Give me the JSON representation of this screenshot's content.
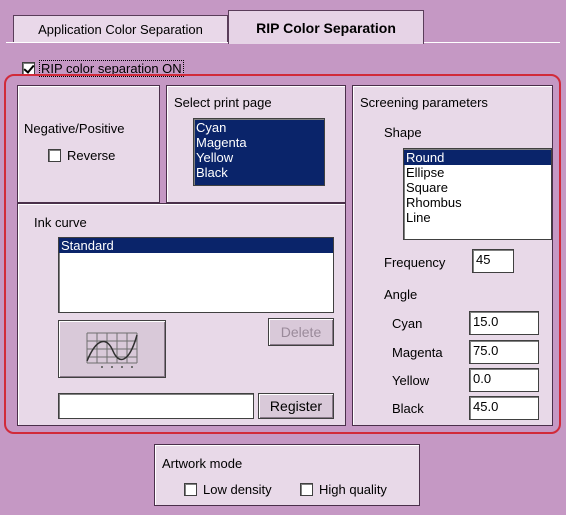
{
  "tabs": [
    {
      "label": "Application Color Separation"
    },
    {
      "label": "RIP Color Separation"
    }
  ],
  "rip_on": {
    "label": "RIP color separation ON",
    "checked": true
  },
  "negpos": {
    "title": "Negative/Positive",
    "reverse_label": "Reverse",
    "reverse_checked": false
  },
  "print_page": {
    "title": "Select print page",
    "items": [
      "Cyan",
      "Magenta",
      "Yellow",
      "Black"
    ]
  },
  "ink_curve": {
    "title": "Ink curve",
    "items": [
      "Standard"
    ],
    "delete_label": "Delete",
    "register_label": "Register",
    "name_value": ""
  },
  "screening": {
    "title": "Screening parameters",
    "shape_label": "Shape",
    "shapes": [
      "Round",
      "Ellipse",
      "Square",
      "Rhombus",
      "Line"
    ],
    "selected_shape": "Round",
    "frequency_label": "Frequency",
    "frequency_value": "45",
    "angle_label": "Angle",
    "angles": [
      {
        "name": "Cyan",
        "value": "15.0"
      },
      {
        "name": "Magenta",
        "value": "75.0"
      },
      {
        "name": "Yellow",
        "value": "0.0"
      },
      {
        "name": "Black",
        "value": "45.0"
      }
    ]
  },
  "artwork": {
    "title": "Artwork mode",
    "low_density_label": "Low density",
    "high_quality_label": "High quality"
  },
  "colors": {
    "highlight": "#d12a3a",
    "selection": "#0a246a",
    "dialog": "#c598c4"
  }
}
